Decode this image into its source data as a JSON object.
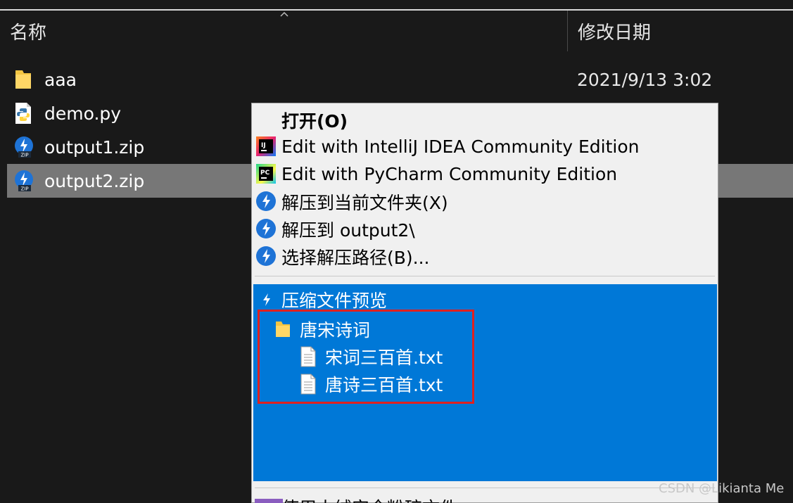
{
  "columns": {
    "name": "名称",
    "date_modified": "修改日期"
  },
  "files": [
    {
      "name": "aaa",
      "date": "2021/9/13 3:02",
      "icon": "folder-icon"
    },
    {
      "name": "demo.py",
      "date": "",
      "icon": "python-file-icon"
    },
    {
      "name": "output1.zip",
      "date": "",
      "icon": "zip-icon"
    },
    {
      "name": "output2.zip",
      "date": "",
      "icon": "zip-icon",
      "selected": true
    }
  ],
  "context_menu": {
    "open": "打开(O)",
    "edit_intellij": "Edit with IntelliJ IDEA Community Edition",
    "edit_pycharm": "Edit with PyCharm Community Edition",
    "extract_here": "解压到当前文件夹(X)",
    "extract_to": "解压到 output2\\",
    "extract_choose": "选择解压路径(B)...",
    "preview": {
      "title": "压缩文件预览",
      "folder": "唐宋诗词",
      "files": [
        "宋词三百首.txt",
        "唐诗三百首.txt"
      ]
    },
    "bottom_partial": "使用火绒安全粉碎文件"
  },
  "watermark": "CSDN @Likianta Me",
  "colors": {
    "background": "#191919",
    "selection": "#777777",
    "menu_bg": "#f0f0f0",
    "preview_bg": "#0078d7",
    "highlight": "#e02020"
  }
}
